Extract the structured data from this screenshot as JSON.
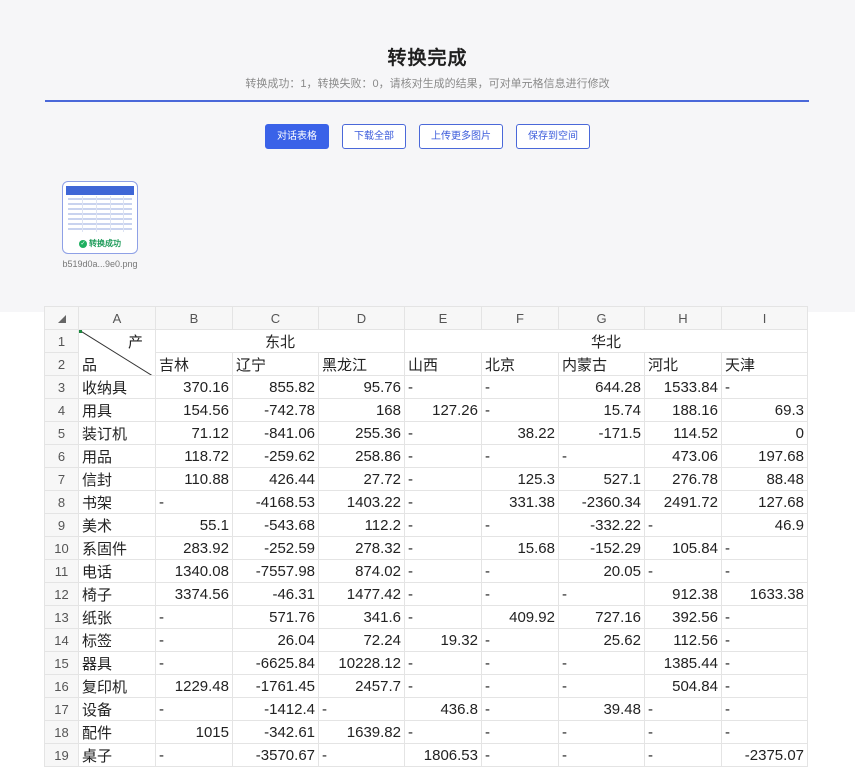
{
  "header": {
    "title": "转换完成",
    "subtitle": "转换成功：1，转换失败：0，请核对生成的结果，可对单元格信息进行修改"
  },
  "buttons": {
    "dialog_table": "对话表格",
    "download_all": "下载全部",
    "upload_more": "上传更多图片",
    "save_to_space": "保存到空间"
  },
  "thumbnail": {
    "status": "转换成功",
    "filename": "b519d0a...9e0.png"
  },
  "colors": {
    "accent": "#3a62e8",
    "success": "#1eaf5f",
    "divider": "#4a68d9"
  },
  "sheet": {
    "columns": [
      "A",
      "B",
      "C",
      "D",
      "E",
      "F",
      "G",
      "H",
      "I"
    ],
    "row_numbers": [
      "1",
      "2",
      "3",
      "4",
      "5",
      "6",
      "7",
      "8",
      "9",
      "10",
      "11",
      "12",
      "13",
      "14",
      "15",
      "16",
      "17",
      "18",
      "19"
    ],
    "header_row1": {
      "corner_top": "产",
      "group_northeast": "东北",
      "group_north": "华北"
    },
    "header_row2": {
      "corner_bottom": "品",
      "provinces": [
        "吉林",
        "辽宁",
        "黑龙江",
        "山西",
        "北京",
        "内蒙古",
        "河北",
        "天津"
      ]
    },
    "rows": [
      {
        "name": "收纳具",
        "values": [
          "370.16",
          "855.82",
          "95.76",
          "-",
          "-",
          "644.28",
          "1533.84",
          "-"
        ]
      },
      {
        "name": "用具",
        "values": [
          "154.56",
          "-742.78",
          "168",
          "127.26",
          "-",
          "15.74",
          "188.16",
          "69.3"
        ]
      },
      {
        "name": "装订机",
        "values": [
          "71.12",
          "-841.06",
          "255.36",
          "-",
          "38.22",
          "-171.5",
          "114.52",
          "0"
        ]
      },
      {
        "name": "用品",
        "values": [
          "118.72",
          "-259.62",
          "258.86",
          "-",
          "-",
          "-",
          "473.06",
          "197.68"
        ]
      },
      {
        "name": "信封",
        "values": [
          "110.88",
          "426.44",
          "27.72",
          "-",
          "125.3",
          "527.1",
          "276.78",
          "88.48"
        ]
      },
      {
        "name": "书架",
        "values": [
          "-",
          "-4168.53",
          "1403.22",
          "-",
          "331.38",
          "-2360.34",
          "2491.72",
          "127.68"
        ]
      },
      {
        "name": "美术",
        "values": [
          "55.1",
          "-543.68",
          "112.2",
          "-",
          "-",
          "-332.22",
          "-",
          "46.9"
        ]
      },
      {
        "name": "系固件",
        "values": [
          "283.92",
          "-252.59",
          "278.32",
          "-",
          "15.68",
          "-152.29",
          "105.84",
          "-"
        ]
      },
      {
        "name": "电话",
        "values": [
          "1340.08",
          "-7557.98",
          "874.02",
          "-",
          "-",
          "20.05",
          "-",
          "-"
        ]
      },
      {
        "name": "椅子",
        "values": [
          "3374.56",
          "-46.31",
          "1477.42",
          "-",
          "-",
          "-",
          "912.38",
          "1633.38"
        ]
      },
      {
        "name": "纸张",
        "values": [
          "-",
          "571.76",
          "341.6",
          "-",
          "409.92",
          "727.16",
          "392.56",
          "-"
        ]
      },
      {
        "name": "标签",
        "values": [
          "-",
          "26.04",
          "72.24",
          "19.32",
          "-",
          "25.62",
          "112.56",
          "-"
        ]
      },
      {
        "name": "器具",
        "values": [
          "-",
          "-6625.84",
          "10228.12",
          "-",
          "-",
          "-",
          "1385.44",
          "-"
        ]
      },
      {
        "name": "复印机",
        "values": [
          "1229.48",
          "-1761.45",
          "2457.7",
          "-",
          "-",
          "-",
          "504.84",
          "-"
        ]
      },
      {
        "name": "设备",
        "values": [
          "-",
          "-1412.4",
          "-",
          "436.8",
          "-",
          "39.48",
          "-",
          "-"
        ]
      },
      {
        "name": "配件",
        "values": [
          "1015",
          "-342.61",
          "1639.82",
          "-",
          "-",
          "-",
          "-",
          "-"
        ]
      },
      {
        "name": "桌子",
        "values": [
          "-",
          "-3570.67",
          "-",
          "1806.53",
          "-",
          "-",
          "-",
          "-2375.07"
        ]
      }
    ]
  }
}
